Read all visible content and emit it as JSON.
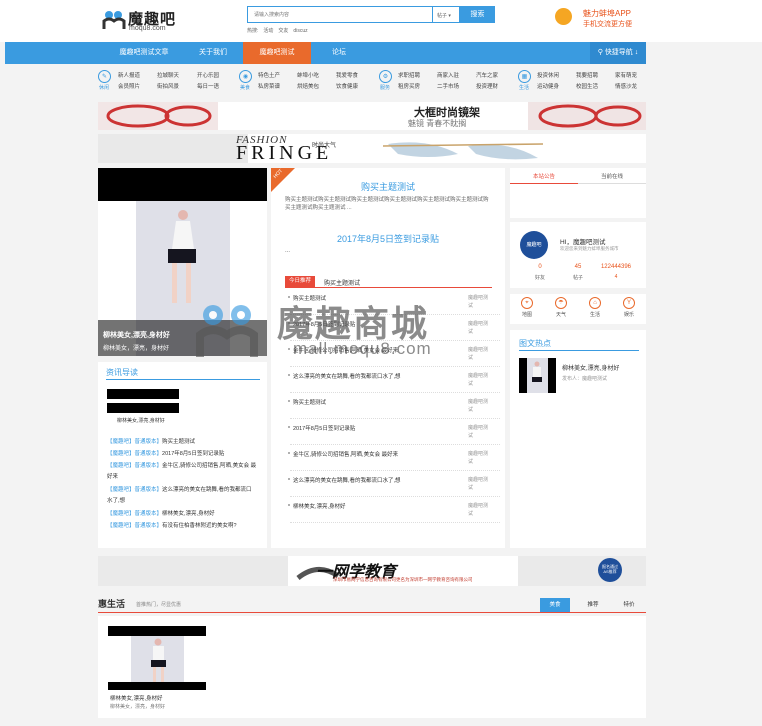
{
  "header": {
    "logo_cn": "魔趣吧",
    "logo_en": "moqu8.com",
    "search_placeholder": "请输入搜索内容",
    "search_scope": "帖子",
    "search_button": "搜索",
    "hot_label": "热搜:",
    "hot_terms": [
      "活动",
      "交友",
      "discuz"
    ],
    "app_title": "魅力蚌埠APP",
    "app_sub": "手机交流更方便"
  },
  "nav": {
    "items": [
      "魔趣吧测试文章",
      "关于我们",
      "魔趣吧测试",
      "论坛"
    ],
    "active_index": 2,
    "quick_nav": "快捷导航"
  },
  "subnav": {
    "groups": [
      {
        "icon_label": "休闲",
        "links": [
          "新人报道",
          "会员照片",
          "拉城聊天",
          "街拍风景",
          "开心乐园",
          "每日一语"
        ]
      },
      {
        "icon_label": "美食",
        "links": [
          "特色土产",
          "私房菜谱",
          "蚌埠小吃",
          "烘焙美包",
          "我爱零食",
          "饮食健康"
        ]
      },
      {
        "icon_label": "服务",
        "links": [
          "求职招聘",
          "租房买房",
          "商家入驻",
          "二手市场",
          "汽车之家",
          "投资理财"
        ]
      },
      {
        "icon_label": "生活",
        "links": [
          "投资休闲",
          "运动健身",
          "我要招聘",
          "校园生活",
          "家有萌宠",
          "情感沙龙"
        ]
      }
    ]
  },
  "banners": {
    "b1_title": "大框时尚镜架",
    "b1_sub": "魅镜 青春不眈搁",
    "b2_text": "FASHION",
    "b2_big": "FRINGE",
    "b2_cn": "时尚大气"
  },
  "slide": {
    "title": "柳林美女,漂亮,身材好",
    "sub": "柳林美女，漂亮，身材好"
  },
  "center": {
    "hot_badge": "HOT",
    "headline": "购买主题测试",
    "summary": "购买主题测试购买主题测试购买主题测试购买主题测试购买主题测试购买主题测试购买主题测试购买主题测试 ...",
    "second_headline": "2017年8月5日签到记录贴",
    "second_dots": "...",
    "today_badge": "今日推荐",
    "today_title": "购买主题测试",
    "list": [
      {
        "title": "购买主题测试",
        "author": "魔趣吧测试"
      },
      {
        "title": "2017年8月5日签到记录贴",
        "author": "魔趣吧测试"
      },
      {
        "title": "金牛区,骑修公司招销售,阿晒,美女会 最好来",
        "author": "魔趣吧测试"
      },
      {
        "title": "这么漂亮的美女在跳舞,看的我都流口水了,想",
        "author": "魔趣吧测试"
      },
      {
        "title": "购买主题测试",
        "author": "魔趣吧测试"
      },
      {
        "title": "2017年8月5日签到记录贴",
        "author": "魔趣吧测试"
      },
      {
        "title": "金牛区,骑修公司招销售,阿晒,美女会 最好来",
        "author": "魔趣吧测试"
      },
      {
        "title": "这么漂亮的美女在跳舞,看的我都流口水了,想",
        "author": "魔趣吧测试"
      },
      {
        "title": "柳林美女,漂亮,身材好",
        "author": "魔趣吧测试"
      }
    ]
  },
  "news": {
    "title": "资讯导读",
    "thumb_caption": "柳林美女,漂亮,身材好",
    "tag": "【魔趣吧】普通版本】",
    "items": [
      "购买主题测试",
      "2017年8月5日签到记录贴",
      "金牛区,骑修公司招销售,阿晒,美女会 最好来",
      "这么漂亮的美女在跳舞,看的我都流口水了,想",
      "柳林美女,漂亮,身材好",
      "有没有住柏香林附近的美女啊?"
    ]
  },
  "right": {
    "tab_notice": "本站公告",
    "tab_online": "当前在线",
    "greeting": "HI，魔趣吧测试",
    "greeting_sub": "欢迎您来到魅力蚌埠服务城市",
    "avatar_text": "魔趣吧",
    "stats": [
      {
        "num": "0",
        "label": "好友"
      },
      {
        "num": "45",
        "label": "帖子"
      },
      {
        "num": "122444396",
        "label": "积分"
      },
      {
        "num": "4",
        "label": ""
      }
    ],
    "tools": [
      "地图",
      "天气",
      "生活",
      "娱乐"
    ],
    "hot_title": "图文热点",
    "hot_item_title": "柳林美女,漂亮,身材好",
    "hot_item_author": "发布人：魔趣吧测试"
  },
  "ad": {
    "brand": "一网学教育",
    "desc": "深圳市易网学信息咨询有限公司更名为深圳市一网学教育咨询有限公司",
    "badge": "报名通过 AS推荐"
  },
  "life": {
    "title": "惠生活",
    "sub": "首推热门，尽显优惠",
    "tabs": [
      "美食",
      "推荐",
      "特价"
    ],
    "item_title": "柳林美女,漂亮,身材好",
    "item_sub": "柳林美女，漂亮，身材好"
  },
  "watermark": {
    "cn": "魔趣商城",
    "en": "mall.moqu8.com"
  },
  "colors": {
    "primary": "#3a9be0",
    "accent": "#e96a2c",
    "red": "#e84a3a"
  }
}
